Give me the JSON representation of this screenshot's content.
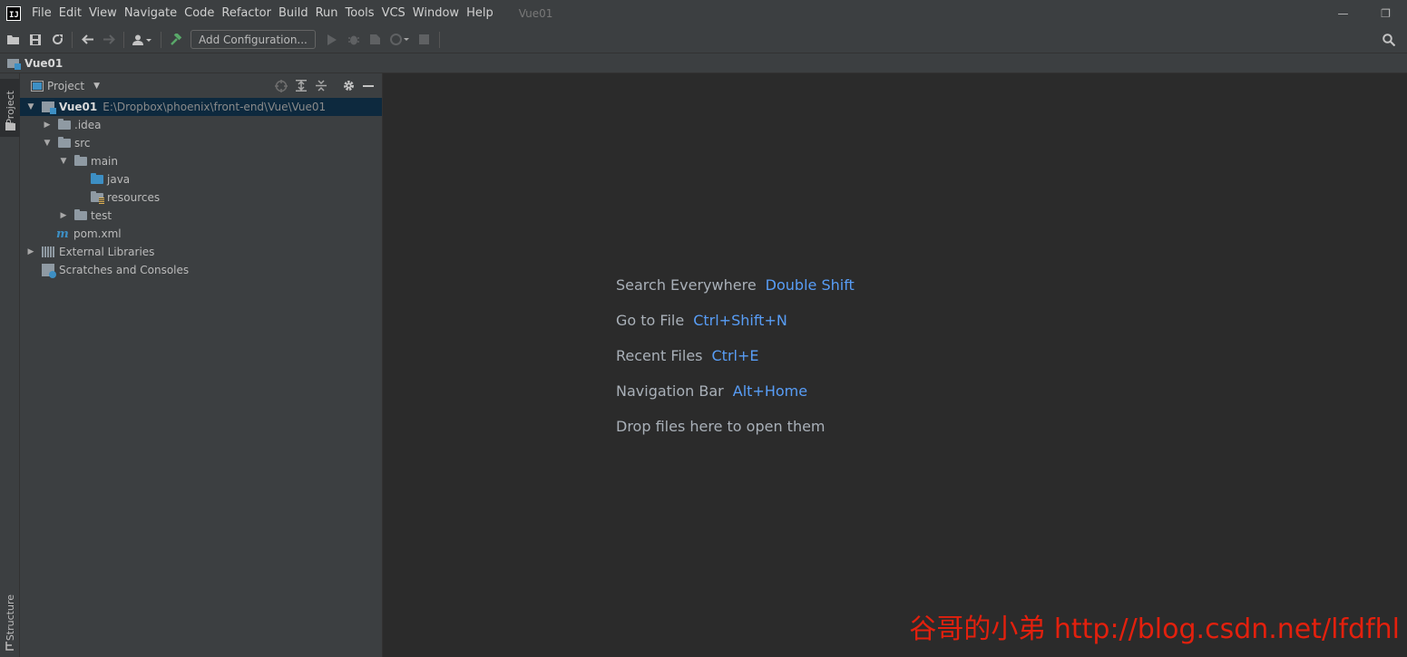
{
  "menubar": {
    "items": [
      "File",
      "Edit",
      "View",
      "Navigate",
      "Code",
      "Refactor",
      "Build",
      "Run",
      "Tools",
      "VCS",
      "Window",
      "Help"
    ],
    "title": "Vue01",
    "minimize_glyph": "—",
    "restore_glyph": "❐"
  },
  "toolbar": {
    "add_configuration_label": "Add Configuration...",
    "icons": [
      "open-icon",
      "save-icon",
      "sync-icon",
      "back-icon",
      "forward-icon",
      "user-icon",
      "build-hammer-icon",
      "run-icon",
      "debug-icon",
      "coverage-icon",
      "profile-icon",
      "stop-icon",
      "search-icon"
    ]
  },
  "navbar": {
    "crumb": "Vue01"
  },
  "left_strip": {
    "project_tab": "Project",
    "structure_tab": "Structure"
  },
  "project_panel": {
    "title": "Project",
    "tree": [
      {
        "label": "Vue01",
        "path": "E:\\Dropbox\\phoenix\\front-end\\Vue\\Vue01"
      },
      {
        "label": ".idea"
      },
      {
        "label": "src"
      },
      {
        "label": "main"
      },
      {
        "label": "java"
      },
      {
        "label": "resources"
      },
      {
        "label": "test"
      },
      {
        "label": "pom.xml"
      },
      {
        "label": "External Libraries"
      },
      {
        "label": "Scratches and Consoles"
      }
    ]
  },
  "editor": {
    "hints": [
      {
        "label": "Search Everywhere",
        "key": "Double Shift"
      },
      {
        "label": "Go to File",
        "key": "Ctrl+Shift+N"
      },
      {
        "label": "Recent Files",
        "key": "Ctrl+E"
      },
      {
        "label": "Navigation Bar",
        "key": "Alt+Home"
      },
      {
        "label": "Drop files here to open them",
        "key": ""
      }
    ]
  },
  "watermark": "谷哥的小弟 http://blog.csdn.net/lfdfhl",
  "colors": {
    "accent_key": "#589df6",
    "panel_bg": "#3c3f41",
    "editor_bg": "#2b2b2b",
    "selection": "#0d293e",
    "watermark": "#e3200d"
  }
}
